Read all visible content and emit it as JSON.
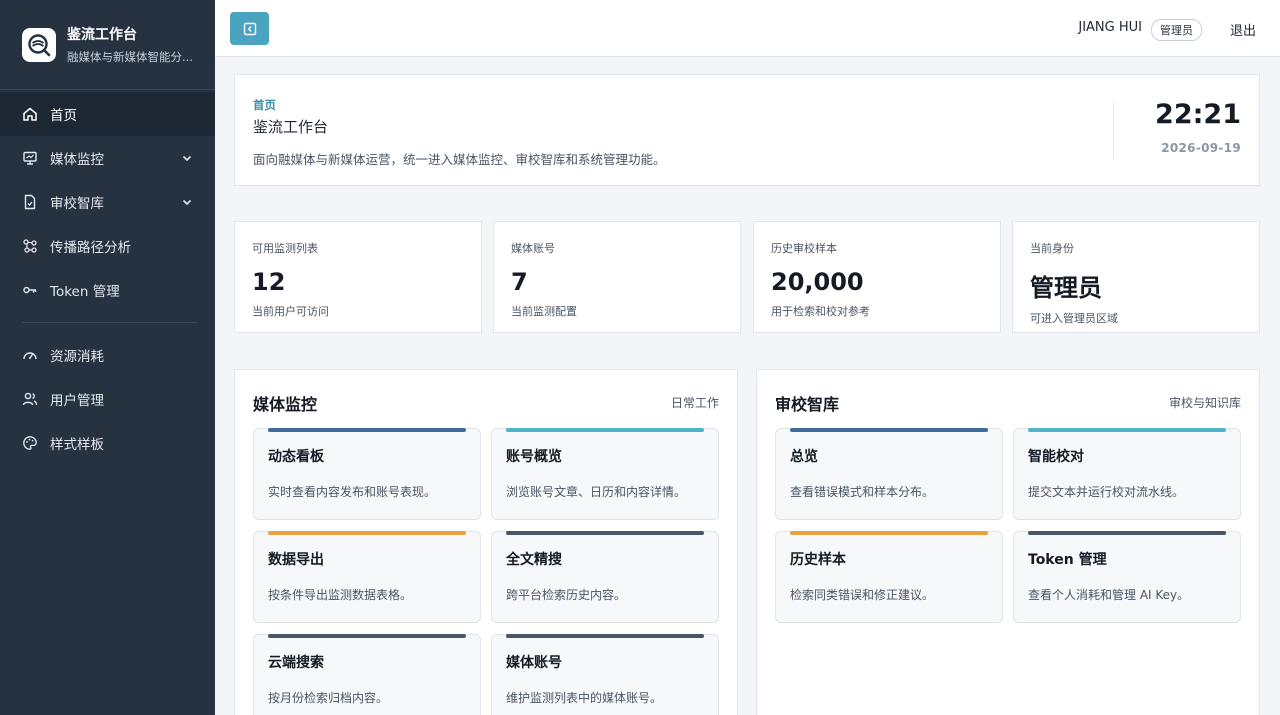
{
  "brand": {
    "title": "鉴流工作台",
    "subtitle": "融媒体与新媒体智能分..."
  },
  "sidebar": {
    "items": [
      {
        "label": "首页",
        "icon": "home-icon"
      },
      {
        "label": "媒体监控",
        "icon": "monitor-icon"
      },
      {
        "label": "审校智库",
        "icon": "document-icon"
      },
      {
        "label": "传播路径分析",
        "icon": "network-icon"
      },
      {
        "label": "Token 管理",
        "icon": "key-icon"
      },
      {
        "label": "资源消耗",
        "icon": "gauge-icon"
      },
      {
        "label": "用户管理",
        "icon": "users-icon"
      },
      {
        "label": "样式样板",
        "icon": "palette-icon"
      }
    ]
  },
  "topbar": {
    "user_name": "JIANG HUI",
    "role": "管理员",
    "logout": "退出"
  },
  "header": {
    "breadcrumb": "首页",
    "title": "鉴流工作台",
    "description": "面向融媒体与新媒体运营，统一进入媒体监控、审校智库和系统管理功能。",
    "time": "22:21",
    "date": "2026-09-19"
  },
  "stats": [
    {
      "label": "可用监测列表",
      "value": "12",
      "note": "当前用户可访问"
    },
    {
      "label": "媒体账号",
      "value": "7",
      "note": "当前监测配置"
    },
    {
      "label": "历史审校样本",
      "value": "20,000",
      "note": "用于检索和校对参考"
    },
    {
      "label": "当前身份",
      "value": "管理员",
      "note": "可进入管理员区域"
    }
  ],
  "panels": {
    "media": {
      "title": "媒体监控",
      "tag": "日常工作",
      "cards": [
        {
          "title": "动态看板",
          "desc": "实时查看内容发布和账号表现。",
          "color": "#3f6b9a"
        },
        {
          "title": "账号概览",
          "desc": "浏览账号文章、日历和内容详情。",
          "color": "#4fb3c9"
        },
        {
          "title": "数据导出",
          "desc": "按条件导出监测数据表格。",
          "color": "#e8a23f"
        },
        {
          "title": "全文精搜",
          "desc": "跨平台检索历史内容。",
          "color": "#4a5565"
        },
        {
          "title": "云端搜索",
          "desc": "按月份检索归档内容。",
          "color": "#4a5565"
        },
        {
          "title": "媒体账号",
          "desc": "维护监测列表中的媒体账号。",
          "color": "#4a5565"
        }
      ]
    },
    "review": {
      "title": "审校智库",
      "tag": "审校与知识库",
      "cards": [
        {
          "title": "总览",
          "desc": "查看错误模式和样本分布。",
          "color": "#3f6b9a"
        },
        {
          "title": "智能校对",
          "desc": "提交文本并运行校对流水线。",
          "color": "#4fb3c9"
        },
        {
          "title": "历史样本",
          "desc": "检索同类错误和修正建议。",
          "color": "#e8a23f"
        },
        {
          "title": "Token 管理",
          "desc": "查看个人消耗和管理 AI Key。",
          "color": "#4a5565"
        }
      ]
    }
  }
}
